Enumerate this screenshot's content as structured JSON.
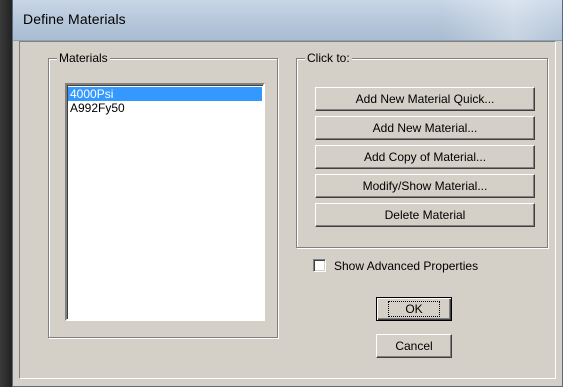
{
  "window": {
    "title": "Define Materials"
  },
  "materials_group": {
    "label": "Materials",
    "items": [
      {
        "label": "4000Psi",
        "selected": true
      },
      {
        "label": "A992Fy50",
        "selected": false
      }
    ]
  },
  "actions_group": {
    "label": "Click to:",
    "buttons": [
      {
        "label": "Add New Material Quick..."
      },
      {
        "label": "Add New Material..."
      },
      {
        "label": "Add Copy of Material..."
      },
      {
        "label": "Modify/Show Material..."
      },
      {
        "label": "Delete Material"
      }
    ]
  },
  "options": {
    "show_advanced_label": "Show Advanced Properties",
    "show_advanced_checked": false
  },
  "dialog_buttons": {
    "ok_label": "OK",
    "cancel_label": "Cancel"
  },
  "colors": {
    "selection": "#3399ff",
    "face": "#d4d0c8"
  }
}
